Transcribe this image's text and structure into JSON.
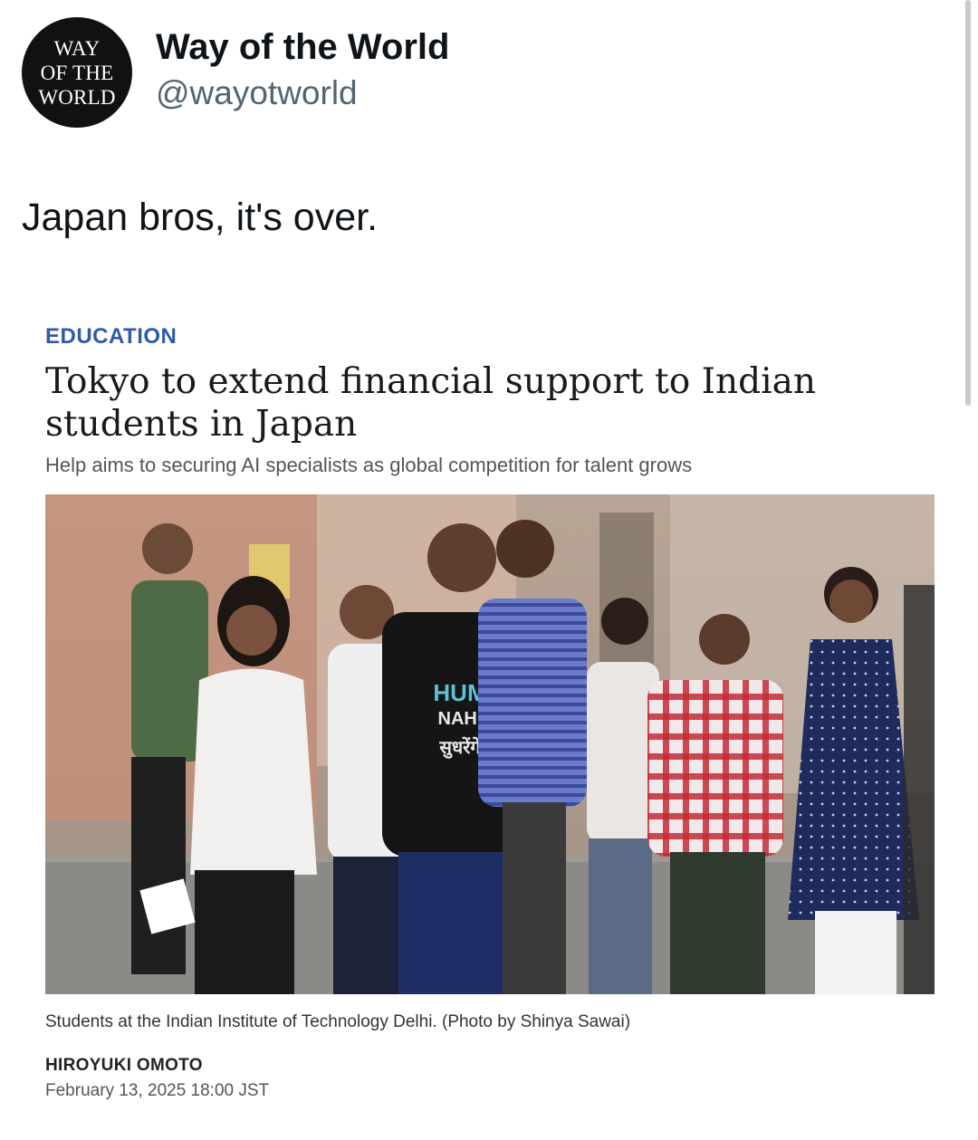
{
  "tweet": {
    "avatar_lines": [
      "WAY",
      "OF THE",
      "WORLD"
    ],
    "display_name": "Way of the World",
    "handle": "@wayotworld",
    "text": "Japan bros, it's over."
  },
  "article": {
    "section": "EDUCATION",
    "headline": "Tokyo to extend financial support to Indian students in Japan",
    "subhead": "Help aims to securing AI specialists as global competition for talent grows",
    "photo_shirt_text": [
      "HUM",
      "NAHI",
      "सुधरेंगे"
    ],
    "caption": "Students at the Indian Institute of Technology Delhi. (Photo by Shinya Sawai)",
    "author": "HIROYUKI OMOTO",
    "date": "February 13, 2025 18:00 JST"
  },
  "colors": {
    "section_label": "#2f5aa8",
    "handle": "#536471",
    "text": "#0f1419"
  }
}
